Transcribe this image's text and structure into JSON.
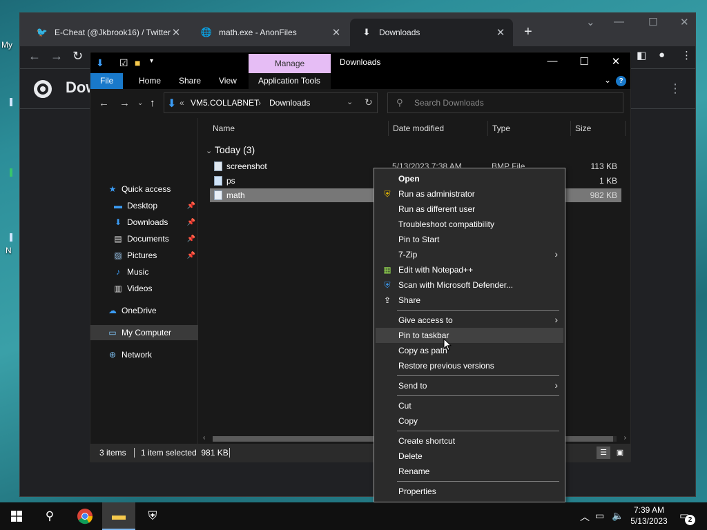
{
  "desktop": {
    "label_top": "My",
    "label_bottom": "N"
  },
  "browser": {
    "tabs": [
      {
        "title": "E-Cheat (@Jkbrook16) / Twitter",
        "icon": "twitter-icon"
      },
      {
        "title": "math.exe - AnonFiles",
        "icon": "globe-icon"
      },
      {
        "title": "Downloads",
        "icon": "download-icon"
      }
    ],
    "page_title": "Downloads"
  },
  "explorer": {
    "ribbon_context": "Manage",
    "title": "Downloads",
    "ribbon_tabs": [
      "File",
      "Home",
      "Share",
      "View",
      "Application Tools"
    ],
    "breadcrumb": [
      "VM5.COLLABNET",
      "Downloads"
    ],
    "breadcrumb_prefix": "<<",
    "search_placeholder": "Search Downloads",
    "nav": {
      "quick_access": "Quick access",
      "items": [
        "Desktop",
        "Downloads",
        "Documents",
        "Pictures",
        "Music",
        "Videos"
      ],
      "onedrive": "OneDrive",
      "my_computer": "My Computer",
      "network": "Network"
    },
    "columns": [
      "Name",
      "Date modified",
      "Type",
      "Size"
    ],
    "group": "Today (3)",
    "files": [
      {
        "name": "screenshot",
        "date": "5/13/2023 7:38 AM",
        "type": "BMP File",
        "size": "113 KB"
      },
      {
        "name": "ps",
        "date": "",
        "type": "",
        "size": "1 KB"
      },
      {
        "name": "math",
        "date": "",
        "type": "",
        "size": "982 KB"
      }
    ],
    "status": {
      "count": "3 items",
      "selected": "1 item selected  981 KB"
    }
  },
  "context_menu": {
    "groups": [
      [
        "Open",
        "Run as administrator",
        "Run as different user",
        "Troubleshoot compatibility",
        "Pin to Start",
        "7-Zip",
        "Edit with Notepad++",
        "Scan with Microsoft Defender...",
        "Share"
      ],
      [
        "Give access to",
        "Pin to taskbar",
        "Copy as path",
        "Restore previous versions"
      ],
      [
        "Send to"
      ],
      [
        "Cut",
        "Copy"
      ],
      [
        "Create shortcut",
        "Delete",
        "Rename"
      ],
      [
        "Properties"
      ]
    ],
    "hovered": "Pin to taskbar"
  },
  "taskbar": {
    "time": "7:39 AM",
    "date": "5/13/2023",
    "notification_count": "2"
  },
  "colors": {
    "accent": "#1979ca",
    "manage_tab": "#e6bdf5",
    "menu_bg": "#2b2b2b"
  }
}
